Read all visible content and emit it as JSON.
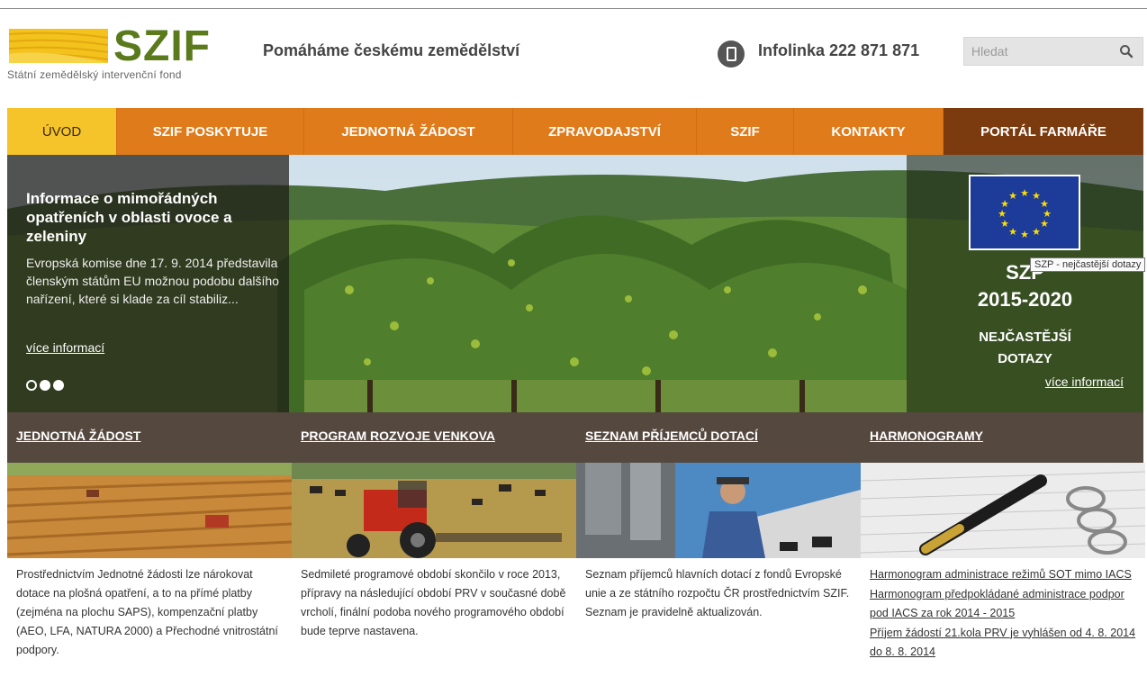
{
  "brand": {
    "logo_text": "SZIF",
    "logo_subtitle": "Státní zemědělský intervenční fond",
    "tagline": "Pomáháme českému zemědělství",
    "infolinka": "Infolinka 222 871 871",
    "accent_color": "#e07b1b",
    "active_color": "#f5c32a",
    "portal_color": "#7b3b0f",
    "section_header_color": "#54483f"
  },
  "search": {
    "placeholder": "Hledat",
    "icon": "search-icon"
  },
  "nav": {
    "items": [
      {
        "label": "ÚVOD",
        "active": true
      },
      {
        "label": "SZIF POSKYTUJE"
      },
      {
        "label": "JEDNOTNÁ ŽÁDOST"
      },
      {
        "label": "ZPRAVODAJSTVÍ"
      },
      {
        "label": "SZIF"
      },
      {
        "label": "KONTAKTY"
      },
      {
        "label": "PORTÁL FARMÁŘE"
      }
    ]
  },
  "hero": {
    "headline": "Informace o mimořádných opatřeních v oblasti ovoce a zeleniny",
    "body": "Evropská komise dne 17. 9. 2014 představila členským státům EU možnou podobu dalšího nařízení, které si klade za cíl stabiliz...",
    "more_link": "více informací",
    "slides_total": 3,
    "active_slide": 1,
    "side": {
      "title": "SZP",
      "years": "2015-2020",
      "sub1": "NEJČASTĚJŠÍ",
      "sub2": "DOTAZY",
      "more_link": "více informací"
    },
    "tooltip": "SZP  - nejčastější dotazy"
  },
  "sections": [
    {
      "title": "JEDNOTNÁ ŽÁDOST",
      "text": "Prostřednictvím Jednotné žádosti lze nárokovat dotace na plošná opatření, a to na přímé platby (zejména na plochu SAPS), kompenzační platby (AEO, LFA, NATURA 2000) a Přechodné vnitrostátní podpory."
    },
    {
      "title": "PROGRAM ROZVOJE VENKOVA",
      "text": "Sedmileté programové období skončilo v roce 2013, přípravy na následující období PRV v současné době vrcholí, finální podoba nového programového období bude teprve nastavena."
    },
    {
      "title": "SEZNAM PŘÍJEMCŮ DOTACÍ",
      "text": "Seznam příjemců hlavních dotací z fondů Evropské unie a ze státního rozpočtu ČR prostřednictvím SZIF. Seznam je pravidelně aktualizován."
    },
    {
      "title": "HARMONOGRAMY",
      "links": [
        "Harmonogram administrace režimů SOT mimo IACS",
        "Harmonogram předpokládané administrace podpor pod IACS za rok 2014 - 2015",
        "Příjem žádostí 21.kola PRV je vyhlášen od 4. 8. 2014 do 8. 8. 2014"
      ]
    }
  ]
}
